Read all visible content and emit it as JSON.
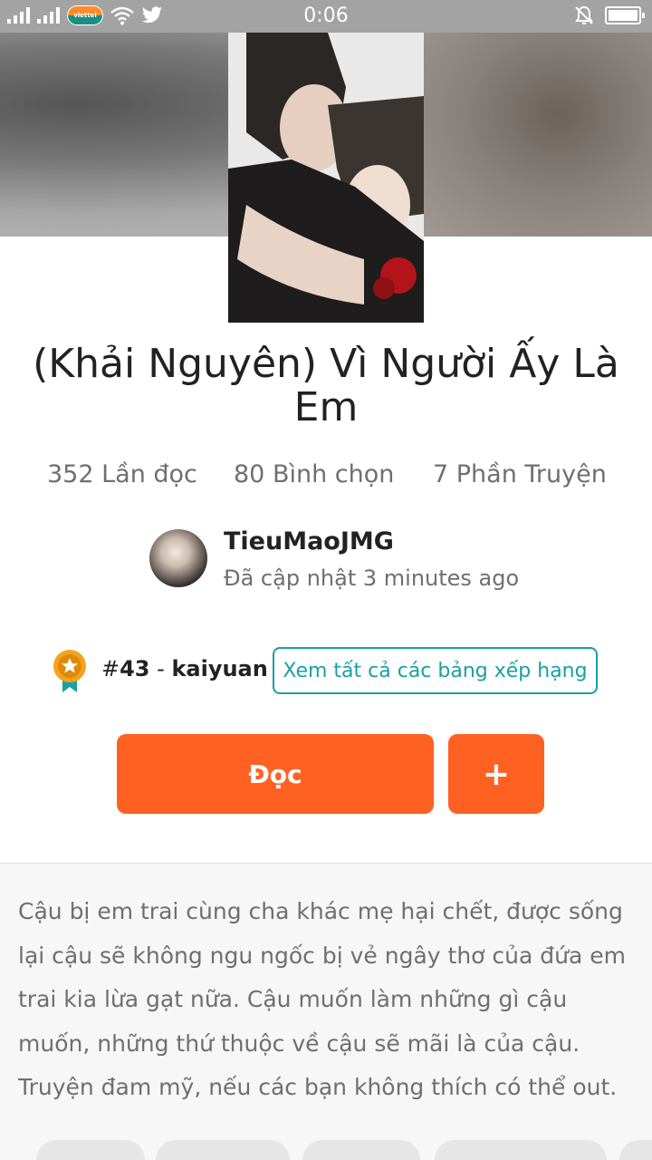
{
  "status_bar": {
    "time": "0:06",
    "carrier": "viettel",
    "icons": [
      "signal-icon",
      "signal-icon",
      "carrier-logo-icon",
      "wifi-icon",
      "twitter-icon",
      "silent-bell-icon",
      "battery-icon"
    ],
    "battery_level": 1.0
  },
  "story": {
    "title": "(Khải Nguyên) Vì Người Ấy Là Em",
    "stats": {
      "reads": "352 Lần đọc",
      "votes": "80 Bình chọn",
      "parts": "7 Phần Truyện"
    },
    "author": {
      "name": "TieuMaoJMG",
      "updated": "Đã cập nhật 3 minutes ago"
    },
    "ranking": {
      "hash": "#",
      "rank": "43",
      "separator": " - ",
      "tag": "kaiyuan",
      "view_all_label": "Xem tất cả các bảng xếp hạng"
    },
    "actions": {
      "read_label": "Đọc",
      "add_label": "+"
    },
    "description": "Cậu bị em trai cùng cha khác mẹ hại chết, được sống lại cậu sẽ không ngu ngốc bị vẻ ngây thơ của đứa em trai kia lừa gạt nữa. Cậu muốn làm những gì cậu muốn, những thứ thuộc về cậu sẽ mãi là của cậu. Truyện đam mỹ, nếu các bạn không thích có thể out."
  },
  "colors": {
    "accent_orange": "#ff6122",
    "link_teal": "#1a9fa6",
    "status_bar_gray": "#a3a3a3",
    "secondary_text": "#6f6f6f"
  }
}
